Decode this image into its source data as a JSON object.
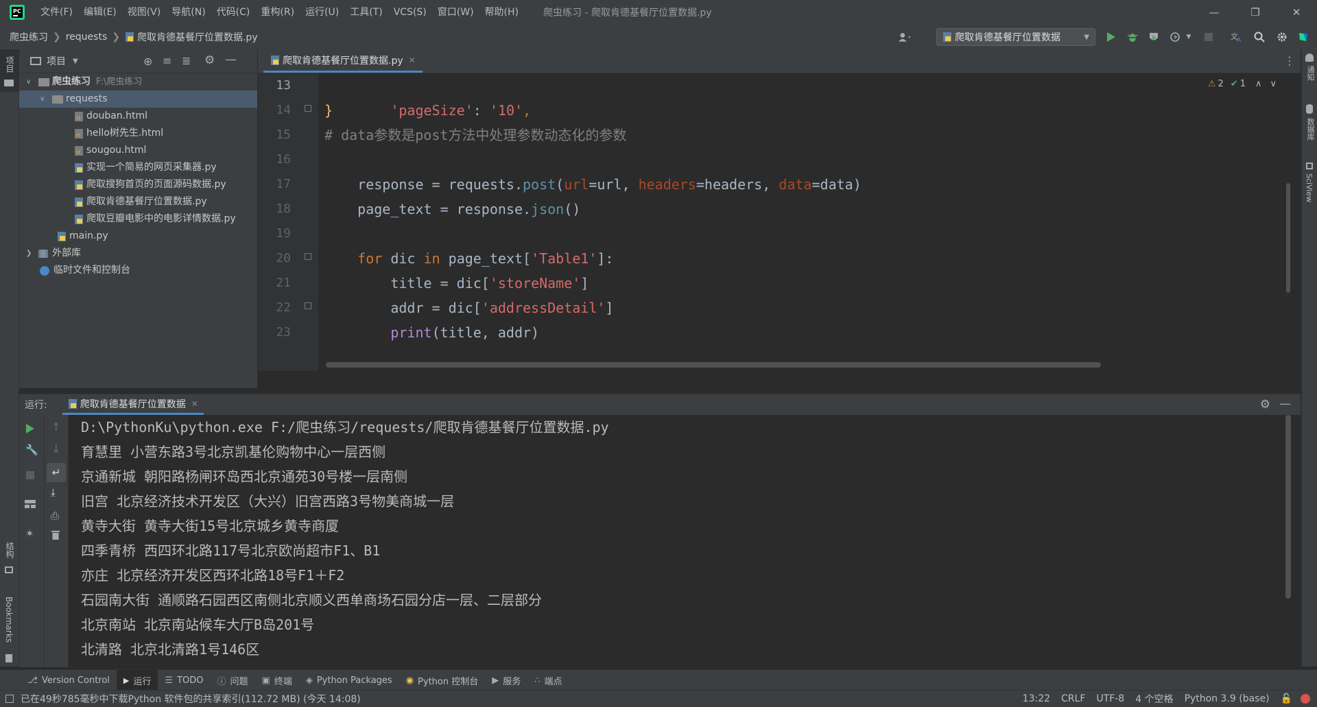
{
  "menu": [
    "文件(F)",
    "编辑(E)",
    "视图(V)",
    "导航(N)",
    "代码(C)",
    "重构(R)",
    "运行(U)",
    "工具(T)",
    "VCS(S)",
    "窗口(W)",
    "帮助(H)"
  ],
  "window_title": "爬虫练习 - 爬取肯德基餐厅位置数据.py",
  "breadcrumb": {
    "project": "爬虫练习",
    "folder": "requests",
    "file": "爬取肯德基餐厅位置数据.py"
  },
  "run_config": "爬取肯德基餐厅位置数据",
  "left_strip": {
    "project": "项目",
    "structure": "结构",
    "bookmarks": "Bookmarks"
  },
  "right_strip": {
    "notifications": "通知",
    "database": "数据库",
    "sciview": "SciView"
  },
  "project_panel": {
    "title": "项目",
    "tree": [
      {
        "label": "爬虫练习",
        "path": "F:\\爬虫练习",
        "type": "folder-root"
      },
      {
        "label": "requests",
        "type": "folder"
      },
      {
        "label": "douban.html",
        "type": "html"
      },
      {
        "label": "hello树先生.html",
        "type": "html"
      },
      {
        "label": "sougou.html",
        "type": "html"
      },
      {
        "label": "实现一个简易的网页采集器.py",
        "type": "py"
      },
      {
        "label": "爬取搜狗首页的页面源码数据.py",
        "type": "py"
      },
      {
        "label": "爬取肯德基餐厅位置数据.py",
        "type": "py"
      },
      {
        "label": "爬取豆瓣电影中的电影详情数据.py",
        "type": "py"
      },
      {
        "label": "main.py",
        "type": "py"
      },
      {
        "label": "外部库",
        "type": "lib"
      },
      {
        "label": "临时文件和控制台",
        "type": "scratch"
      }
    ]
  },
  "editor": {
    "tab_label": "爬取肯德基餐厅位置数据.py",
    "inspections": {
      "warnings": "2",
      "ok": "1"
    },
    "line_numbers": [
      "13",
      "14",
      "15",
      "16",
      "17",
      "18",
      "19",
      "20",
      "21",
      "22",
      "23"
    ],
    "code": {
      "l13_key": "'pageSize'",
      "l13_colon": ": ",
      "l13_val": "'10'",
      "l13_comma": ",",
      "l14": "}",
      "l15": "# data参数是post方法中处理参数动态化的参数",
      "l16_a": "response = requests.",
      "l16_post": "post",
      "l16_b": "(",
      "l16_k1": "url",
      "l16_c": "=url, ",
      "l16_k2": "headers",
      "l16_d": "=headers, ",
      "l16_k3": "data",
      "l16_e": "=data)",
      "l17_a": "page_text = response.",
      "l17_json": "json",
      "l17_b": "()",
      "l19_for": "for",
      "l19_a": " dic ",
      "l19_in": "in",
      "l19_b": " page_text[",
      "l19_str": "'Table1'",
      "l19_c": "]:",
      "l20_a": "    title = dic[",
      "l20_str": "'storeName'",
      "l20_b": "]",
      "l21_a": "    addr = dic[",
      "l21_str": "'addressDetail'",
      "l21_b": "]",
      "l22_print": "print",
      "l22_a": "(title, addr)"
    }
  },
  "run_panel": {
    "label": "运行:",
    "tab": "爬取肯德基餐厅位置数据",
    "output": [
      "D:\\PythonKu\\python.exe F:/爬虫练习/requests/爬取肯德基餐厅位置数据.py",
      "育慧里 小营东路3号北京凯基伦购物中心一层西侧",
      "京通新城 朝阳路杨闸环岛西北京通苑30号楼一层南侧",
      "旧宫 北京经济技术开发区（大兴）旧宫西路3号物美商城一层",
      "黄寺大街 黄寺大街15号北京城乡黄寺商厦",
      "四季青桥 西四环北路117号北京欧尚超市F1、B1",
      "亦庄 北京经济开发区西环北路18号F1＋F2",
      "石园南大街 通顺路石园西区南侧北京顺义西单商场石园分店一层、二层部分",
      "北京南站 北京南站候车大厅B岛201号",
      "北清路 北京北清路1号146区"
    ]
  },
  "tool_tabs": [
    "Version Control",
    "运行",
    "TODO",
    "问题",
    "终端",
    "Python Packages",
    "Python 控制台",
    "服务",
    "端点"
  ],
  "status": {
    "message": "已在49秒785毫秒中下载Python 软件包的共享索引(112.72 MB) (今天 14:08)",
    "position": "13:22",
    "line_sep": "CRLF",
    "encoding": "UTF-8",
    "indent": "4 个空格",
    "interpreter": "Python 3.9 (base)"
  },
  "colors": {
    "accent": "#4a88c7",
    "run_green": "#59a869",
    "selection": "#4b6eaf"
  }
}
